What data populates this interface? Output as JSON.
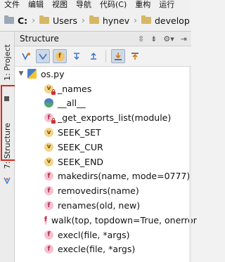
{
  "menu": [
    "文件",
    "编辑",
    "视图",
    "导航",
    "代码(C)",
    "重构",
    "运行"
  ],
  "breadcrumb": [
    "C:",
    "Users",
    "hynev",
    "develop"
  ],
  "side_tabs": {
    "project": "1: Project",
    "structure": "7: Structure"
  },
  "panel": {
    "title": "Structure"
  },
  "toolbar": {
    "visibility_button": "f"
  },
  "tree": {
    "root": "os.py",
    "items": [
      {
        "label": "_names",
        "kind": "v",
        "private": true
      },
      {
        "label": "__all__",
        "kind": "all",
        "private": false
      },
      {
        "label": "_get_exports_list(module)",
        "kind": "f",
        "private": true
      },
      {
        "label": "SEEK_SET",
        "kind": "v",
        "private": false
      },
      {
        "label": "SEEK_CUR",
        "kind": "v",
        "private": false
      },
      {
        "label": "SEEK_END",
        "kind": "v",
        "private": false
      },
      {
        "label": "makedirs(name, mode=0777)",
        "kind": "f",
        "private": false
      },
      {
        "label": "removedirs(name)",
        "kind": "f",
        "private": false
      },
      {
        "label": "renames(old, new)",
        "kind": "f",
        "private": false
      },
      {
        "label": "walk(top, topdown=True, onerror",
        "kind": "f",
        "private": false
      },
      {
        "label": "execl(file, *args)",
        "kind": "f",
        "private": false
      },
      {
        "label": "execle(file, *args)",
        "kind": "f",
        "private": false
      }
    ]
  },
  "colors": {
    "highlight_box": "#e0241b",
    "function_icon": "#f6c3cf",
    "variable_icon": "#f3d58b"
  }
}
